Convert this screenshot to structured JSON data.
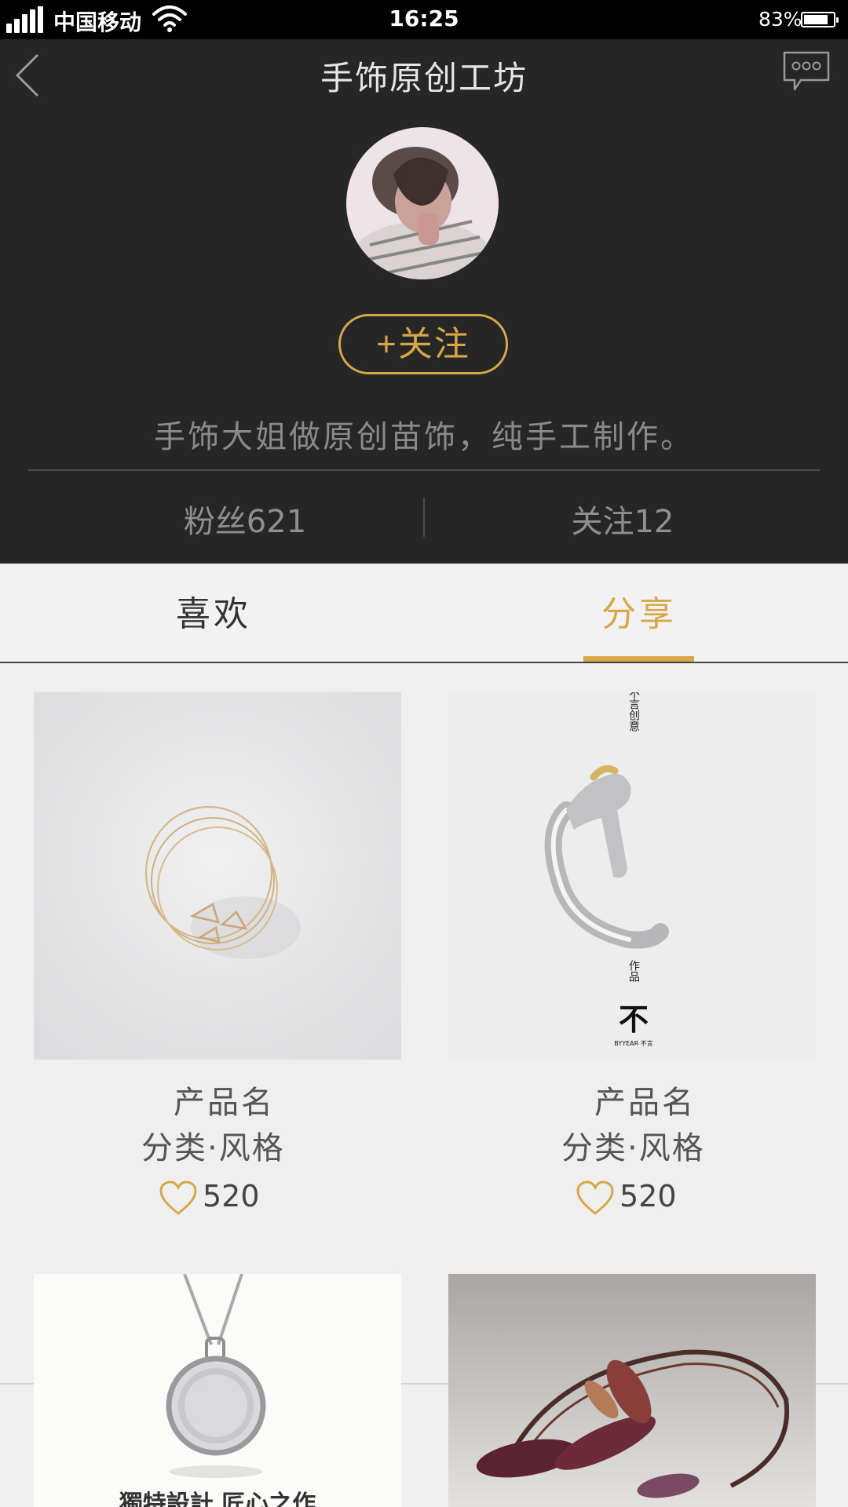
{
  "status_bar": {
    "carrier": "中国移动",
    "time": "16:25",
    "battery_percent": "83%",
    "battery_level": 0.83
  },
  "header": {
    "title": "手饰原创工坊",
    "follow_label": "+关注",
    "bio": "手饰大姐做原创苗饰，纯手工制作。",
    "fans": "粉丝621",
    "following": "关注12"
  },
  "tabs": [
    {
      "label": "喜欢",
      "active": false
    },
    {
      "label": "分享",
      "active": true
    }
  ],
  "products": [
    {
      "name": "产品名",
      "category": "分类·风格",
      "likes": "520"
    },
    {
      "name": "产品名",
      "category": "分类·风格",
      "likes": "520",
      "image_text": {
        "vertical_top": "不言创意",
        "vertical_bottom": "作品",
        "logo": "不",
        "brand": "BYYEAR 不言"
      }
    },
    {
      "image_text": {
        "caption": "獨特設計 匠心之作"
      }
    },
    {}
  ],
  "colors": {
    "accent": "#d6a84a",
    "header_bg": "#262626",
    "page_bg": "#efeff0"
  },
  "icons": [
    "signal-icon",
    "wifi-icon",
    "battery-icon",
    "back-icon",
    "message-icon",
    "heart-icon"
  ]
}
